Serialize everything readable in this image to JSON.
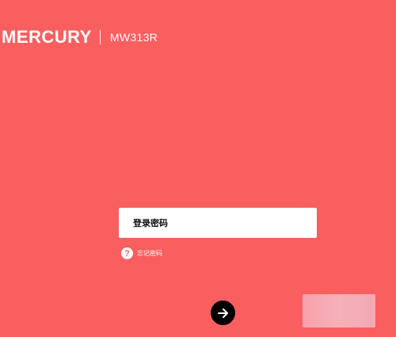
{
  "header": {
    "brand": "MERCURY",
    "model": "MW313R"
  },
  "login": {
    "password_placeholder": "登录密码",
    "forgot_password": "忘记密码",
    "help_icon": "question-circle-icon",
    "submit_icon": "arrow-right-icon"
  },
  "colors": {
    "background": "#f95f5f",
    "input_background": "#ffffff",
    "submit_button": "#000000"
  }
}
